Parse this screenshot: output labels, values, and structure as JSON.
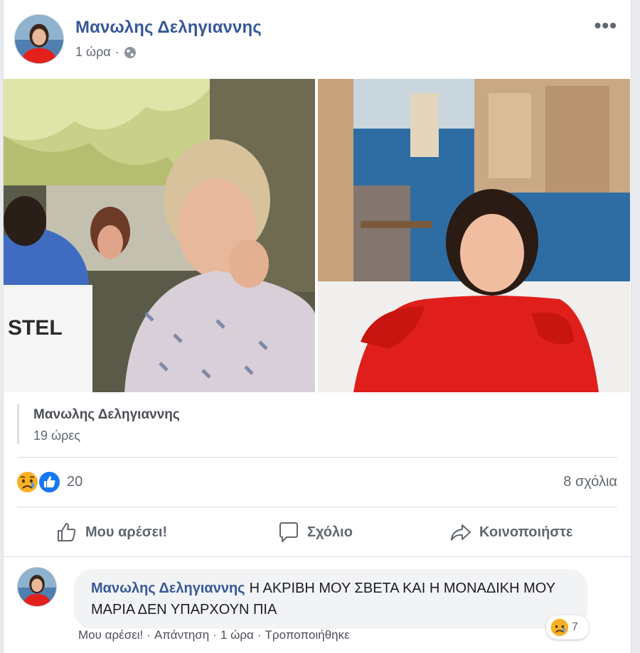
{
  "post": {
    "author": "Μανωλης Δεληγιαννης",
    "time": "1 ώρα",
    "time_separator": "·",
    "audience_icon": "globe-icon",
    "more_label": "•••"
  },
  "shared": {
    "author": "Μανωλης Δεληγιαννης",
    "time": "19 ώρες"
  },
  "reactions": {
    "types": [
      "sad",
      "like"
    ],
    "count": "20",
    "comments": "8 σχόλια"
  },
  "actions": {
    "like": "Μου αρέσει!",
    "comment": "Σχόλιο",
    "share": "Κοινοποιήστε"
  },
  "comment": {
    "author": "Μανωλης Δεληγιαννης",
    "text": "Η ΑΚΡΙΒΗ ΜΟΥ ΣΒΕΤΑ ΚΑΙ Η ΜΟΝΑΔΙΚΗ ΜΟΥ ΜΑΡΙΑ ΔΕΝ ΥΠΑΡΧΟΥΝ ΠΙΑ",
    "like": "Μου αρέσει!",
    "reply": "Απάντηση",
    "time": "1 ώρα",
    "edited": "Τροποποιήθηκε",
    "separator": "·",
    "reaction_count": "7"
  },
  "colors": {
    "link": "#365899",
    "like_blue": "#1877f2",
    "sad_yellow": "#f7b125",
    "muted": "#606770"
  }
}
